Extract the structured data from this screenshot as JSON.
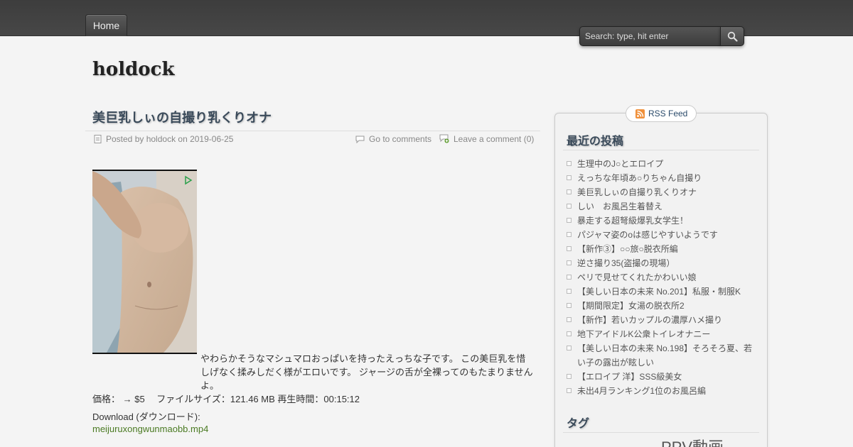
{
  "nav": {
    "home_label": "Home"
  },
  "search": {
    "placeholder": "Search: type, hit enter"
  },
  "site": {
    "title": "holdock"
  },
  "post": {
    "title": "美巨乳しぃの自撮り乳くりオナ",
    "meta_posted": "Posted by holdock on 2019-06-25",
    "meta_go_to_comments": "Go to comments",
    "meta_leave_comment": "Leave a comment (0)",
    "body_line1": "やわらかそうなマシュマロおっぱいを持ったえっちな子です。 この美巨乳を惜しげなく揉みしだく様がエロいです。 ジャージの舌が全裸ってのもたまりませんよ。",
    "body_line2": "価格： → $5　 ファイルサイズ：121.46 MB 再生時間：00:15:12",
    "download_label": "Download (ダウンロード):",
    "download_link": "meijuruxongwunmaobb.mp4"
  },
  "sidebar": {
    "rss_label": "RSS Feed",
    "recent_title": "最近の投稿",
    "recent_posts": [
      "生理中のJ○とエロイプ",
      "えっちな年頃あ○りちゃん自撮り",
      "美巨乳しぃの自撮り乳くりオナ",
      "しい　お風呂生着替え",
      "暴走する超弩級爆乳女学生！",
      "パジャマ姿のoは感じやすいようです",
      "【新作③】○○旅○脱衣所編",
      "逆さ撮り35(盗撮の現場）",
      "ペリで見せてくれたかわいい娘",
      "【美しい日本の未来 No.201】私服・制服K",
      "【期間限定】女湯の脱衣所2",
      "【新作】若いカップルの濃厚ハメ撮り",
      "地下アイドルK公衆トイレオナニー",
      "【美しい日本の未来 No.198】そろそろ夏、若い子の露出が眩しい",
      "【エロイプ 洋】SSS級美女",
      "未出4月ランキング1位のお風呂編"
    ],
    "tags_title": "タグ",
    "tag_cloud_text": "PPV動画"
  },
  "colors": {
    "topbar": "#444444",
    "background": "#f4f4f4",
    "link_green": "#4a7a22",
    "title_blue": "#3a4a5a"
  }
}
